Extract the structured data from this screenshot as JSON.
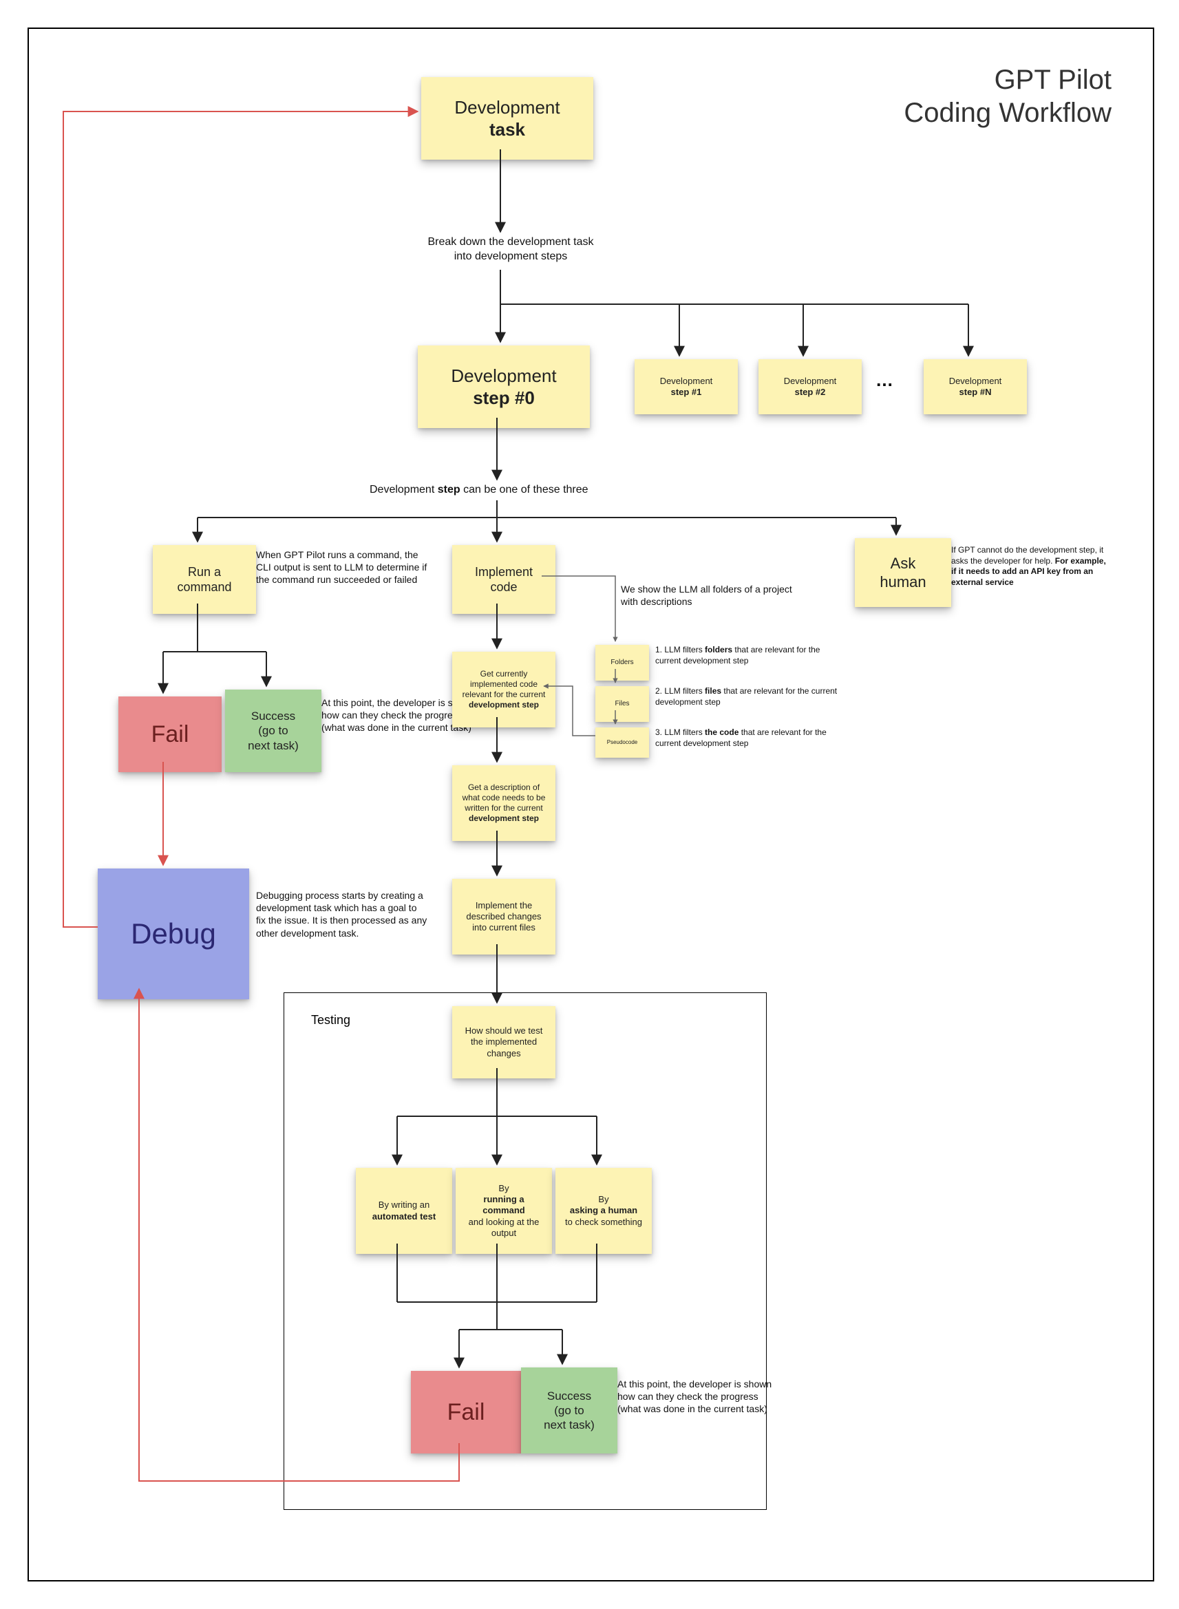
{
  "title_line1": "GPT Pilot",
  "title_line2": "Coding Workflow",
  "nodes": {
    "dev_task": {
      "line1": "Development",
      "bold": "task"
    },
    "breakdown": "Break down the development task\ninto development steps",
    "step0": {
      "line1": "Development",
      "bold": "step #0"
    },
    "step1": {
      "line1": "Development",
      "bold": "step #1"
    },
    "step2": {
      "line1": "Development",
      "bold": "step #2"
    },
    "stepN": {
      "line1": "Development",
      "bold": "step #N"
    },
    "step_kinds": "Development <b>step</b> can be one of these three",
    "run_cmd": {
      "line1": "Run a",
      "line2": "command"
    },
    "run_cmd_desc": "When GPT Pilot runs a command, the CLI output is sent to LLM to determine if the command run succeeded or failed",
    "impl_code": {
      "line1": "Implement",
      "line2": "code"
    },
    "ask_human": {
      "line1": "Ask",
      "line2": "human"
    },
    "ask_human_desc": "If GPT cannot do the development step, it asks the developer for help. <b>For example, if it needs to add an API key from an external service</b>",
    "fail1": "Fail",
    "success1": {
      "line1": "Success",
      "line2": "(go to",
      "line3": "next task)"
    },
    "success1_desc": "At this point, the developer is shown how can they check the progress (what was done in the current task)",
    "debug": "Debug",
    "debug_desc": "Debugging process starts by creating a development task which has a goal to fix the issue. It is then processed as any other development task.",
    "folders_desc": "We show the LLM all folders of a project with descriptions",
    "folders": "Folders",
    "files": "Files",
    "pseudo": "Pseudocode",
    "filter1": "1. LLM filters <b>folders</b> that are relevant for the current  development step",
    "filter2": "2. LLM filters <b>files</b> that are relevant for the current  development step",
    "filter3": "3. LLM filters <b>the code</b> that are relevant for the current  development step",
    "get_code": "Get currently implemented code relevant for the current <b>development step</b>",
    "get_desc": "Get a description of what code needs to be written for the current <b>development step</b>",
    "impl_changes": "Implement the described changes into current files",
    "testing_label": "Testing",
    "how_test": "How should we test the implemented changes",
    "test_auto": "By writing an <b>automated test</b>",
    "test_cmd": "By <b>running a command</b> and looking at the output",
    "test_human": "By <b>asking a human</b> to check something",
    "fail2": "Fail",
    "success2": {
      "line1": "Success",
      "line2": "(go to",
      "line3": "next task)"
    },
    "success2_desc": "At this point, the developer is shown how can they check the progress (what was done in the current task)"
  },
  "dots": "…",
  "colors": {
    "edge": "#222",
    "red_edge": "#d9534f"
  }
}
